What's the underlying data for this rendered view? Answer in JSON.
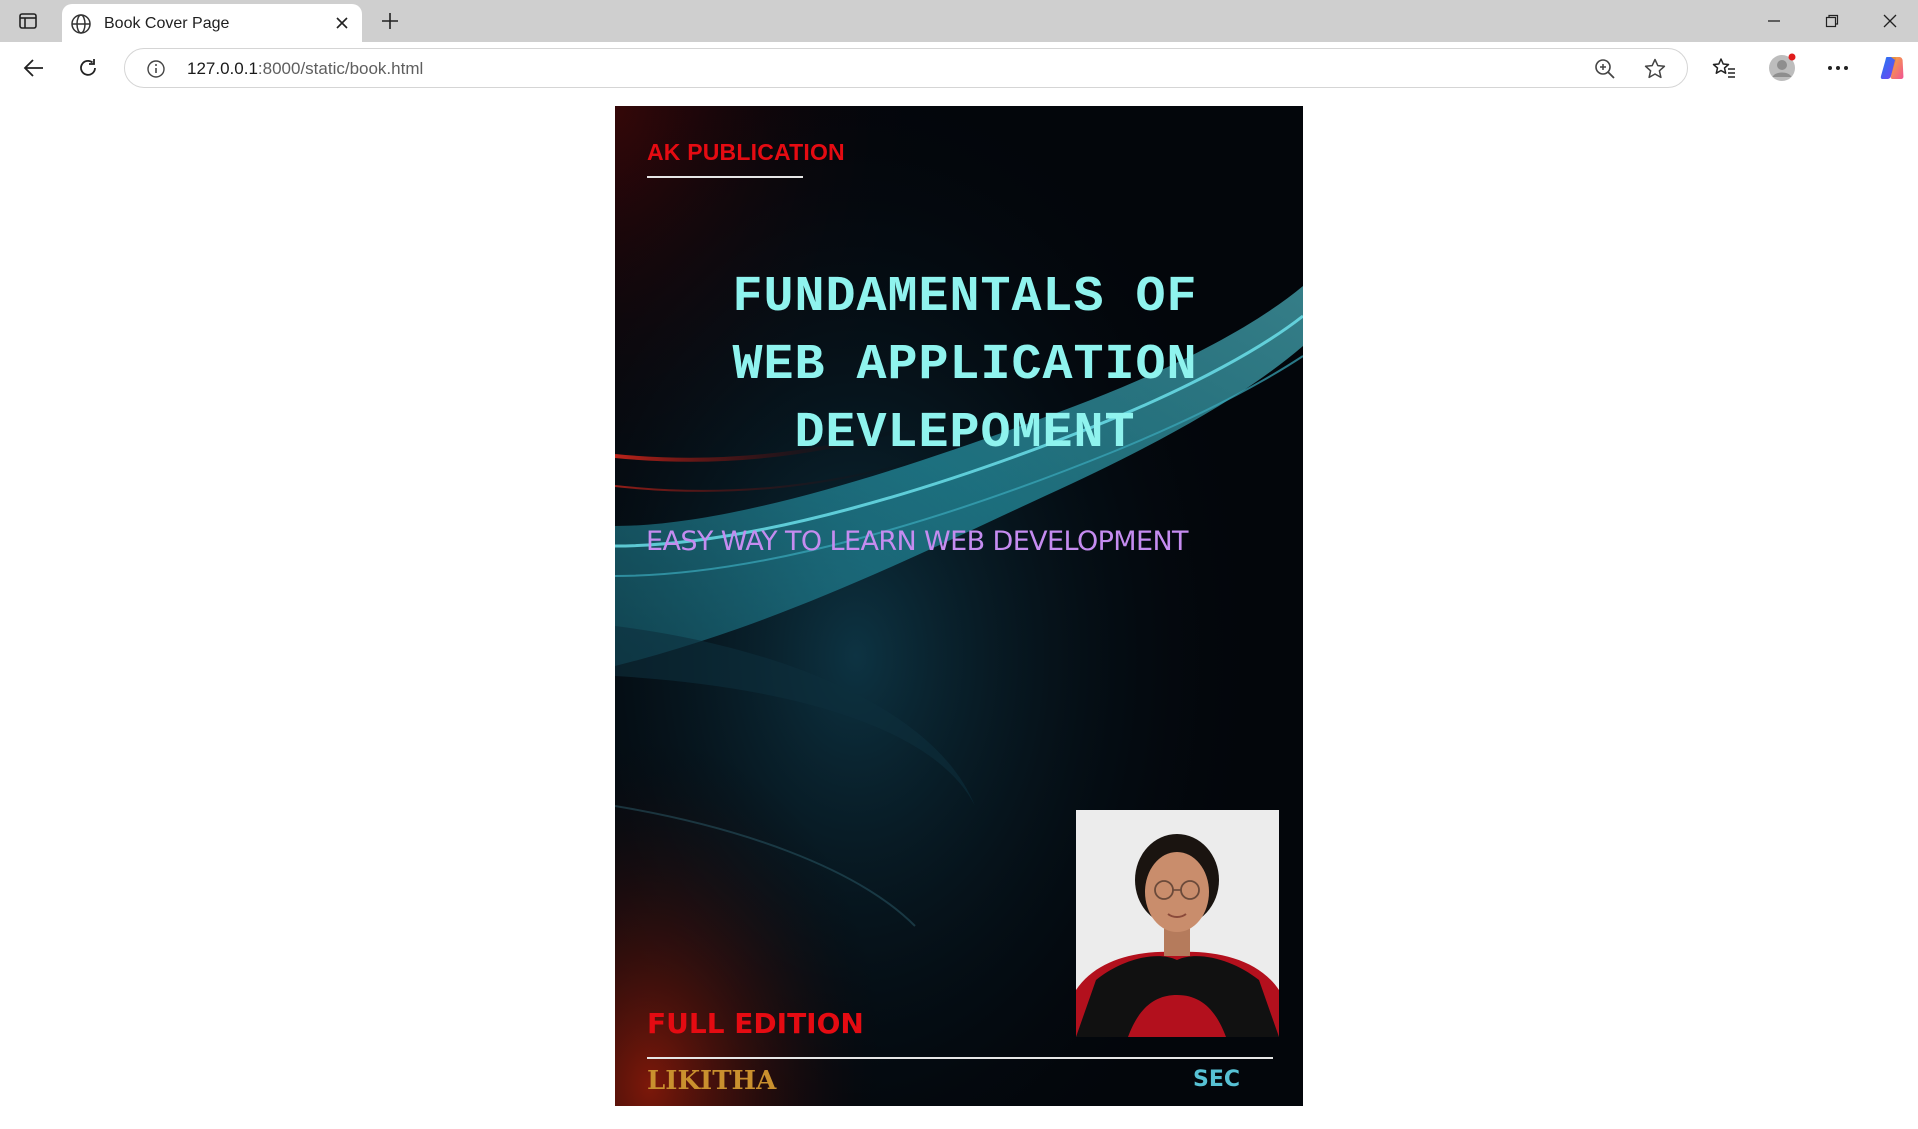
{
  "browser": {
    "tab_title": "Book Cover Page",
    "url_host": "127.0.0.1",
    "url_path": ":8000/static/book.html",
    "icons": [
      "sidebar-icon",
      "globe-icon",
      "close-icon",
      "plus-icon",
      "minimize-icon",
      "restore-icon",
      "window-close-icon",
      "back-icon",
      "reload-icon",
      "info-icon",
      "zoom-icon",
      "star-icon",
      "favorites-icon",
      "profile-icon",
      "more-icon",
      "copilot-icon"
    ]
  },
  "cover": {
    "publisher": "AK PUBLICATION",
    "title_lines": [
      "FUNDAMENTALS OF",
      "WEB APPLICATION",
      "DEVLEPOMENT"
    ],
    "subtitle": "EASY WAY TO LEARN WEB DEVELOPMENT",
    "edition": "FULL EDITION",
    "author": "LIKITHA",
    "department": "SEC",
    "colors": {
      "publisher": "#e50b12",
      "title": "#8ff3ee",
      "subtitle": "#c58cf0",
      "edition": "#e50b12",
      "author": "#c9902e",
      "department": "#57c1d4",
      "background": "#03060b"
    }
  }
}
